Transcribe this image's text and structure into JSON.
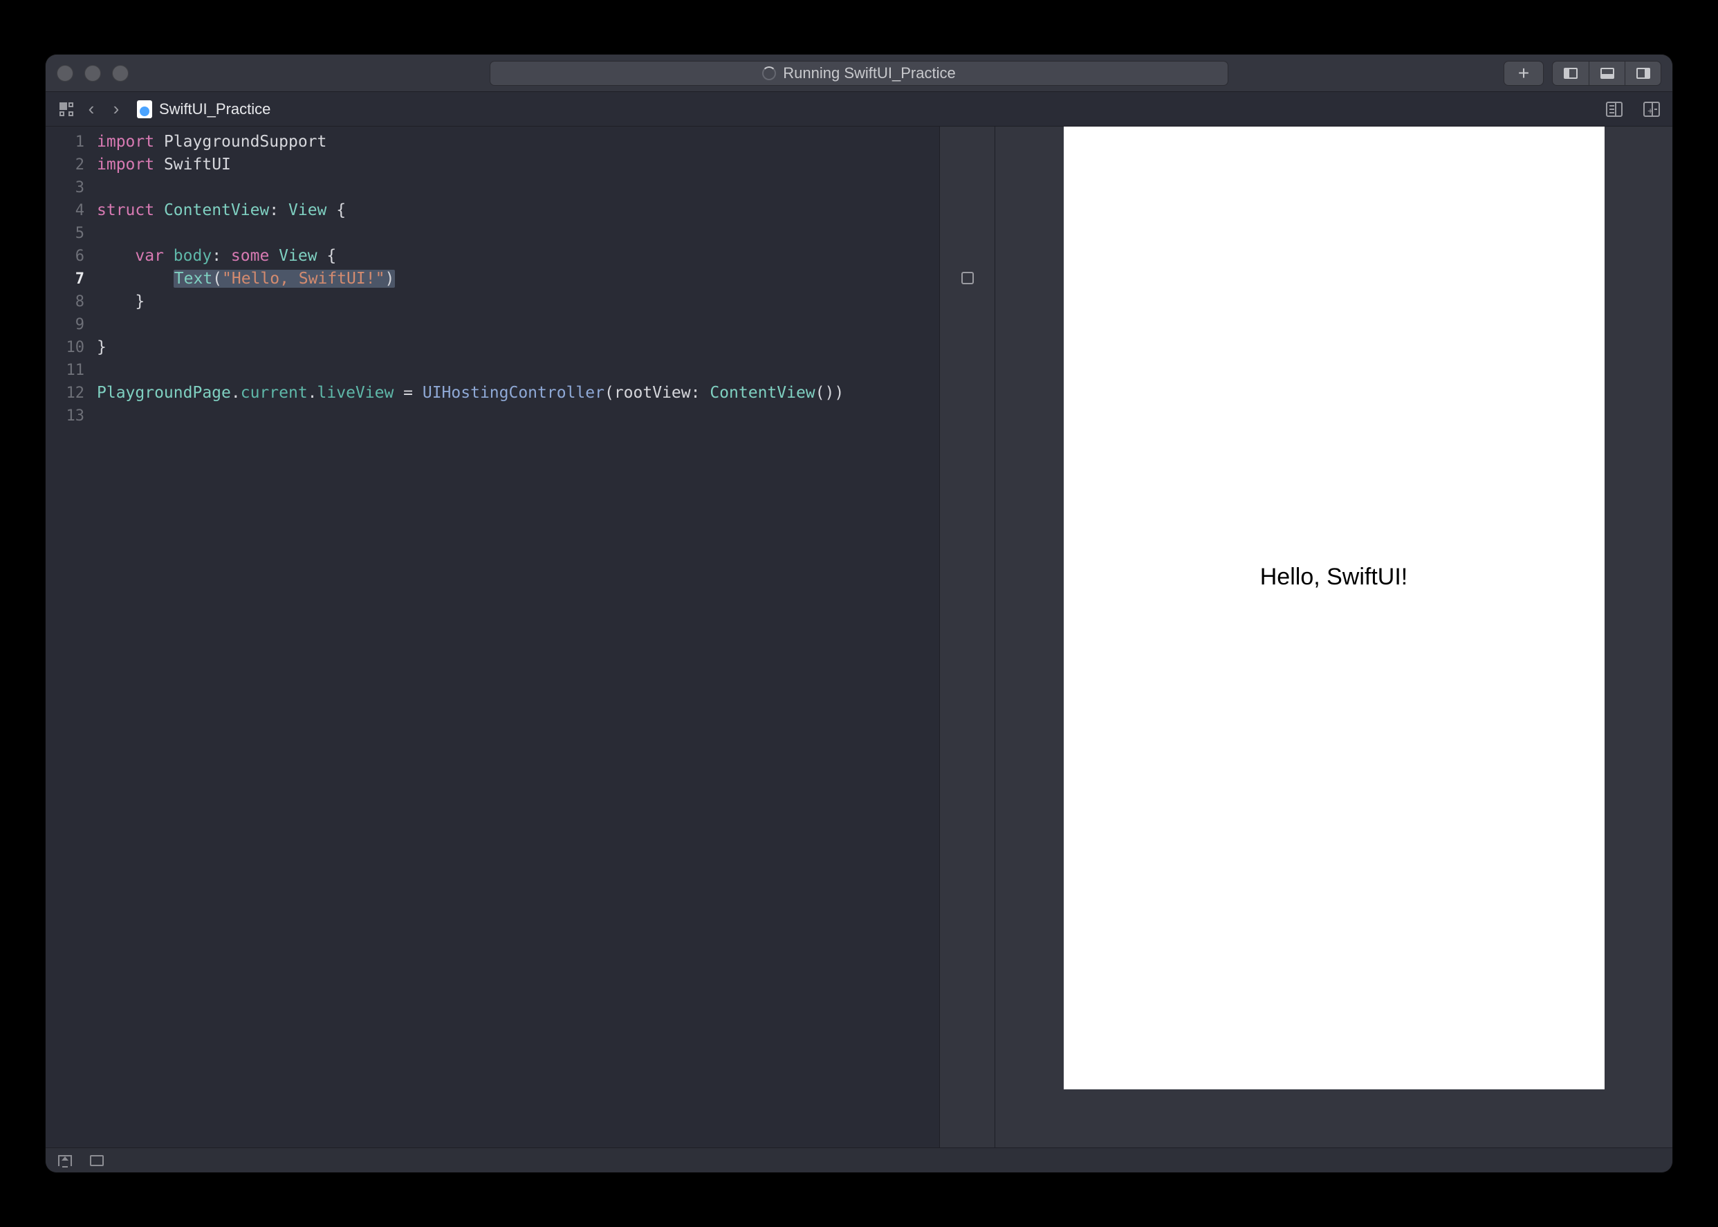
{
  "titlebar": {
    "status_text": "Running SwiftUI_Practice"
  },
  "tabbar": {
    "file_name": "SwiftUI_Practice"
  },
  "code": {
    "lines": [
      {
        "n": "1"
      },
      {
        "n": "2"
      },
      {
        "n": "3"
      },
      {
        "n": "4"
      },
      {
        "n": "5"
      },
      {
        "n": "6"
      },
      {
        "n": "7"
      },
      {
        "n": "8"
      },
      {
        "n": "9"
      },
      {
        "n": "10"
      },
      {
        "n": "11"
      },
      {
        "n": "12"
      },
      {
        "n": "13"
      }
    ],
    "tok": {
      "import": "import",
      "PlaygroundSupport": "PlaygroundSupport",
      "SwiftUI": "SwiftUI",
      "struct": "struct",
      "ContentView": "ContentView",
      "colon": ":",
      "View": "View",
      "lbrace": "{",
      "rbrace": "}",
      "var": "var",
      "body": "body",
      "some": "some",
      "Text": "Text",
      "lparen": "(",
      "rparen": ")",
      "hello_str": "\"Hello, SwiftUI!\"",
      "PlaygroundPage": "PlaygroundPage",
      "current": "current",
      "liveView": "liveView",
      "eq": " = ",
      "UIHostingController": "UIHostingController",
      "rootView": "rootView",
      "dot": ".",
      "empty_parens": "()"
    }
  },
  "preview": {
    "hello": "Hello, SwiftUI!"
  }
}
